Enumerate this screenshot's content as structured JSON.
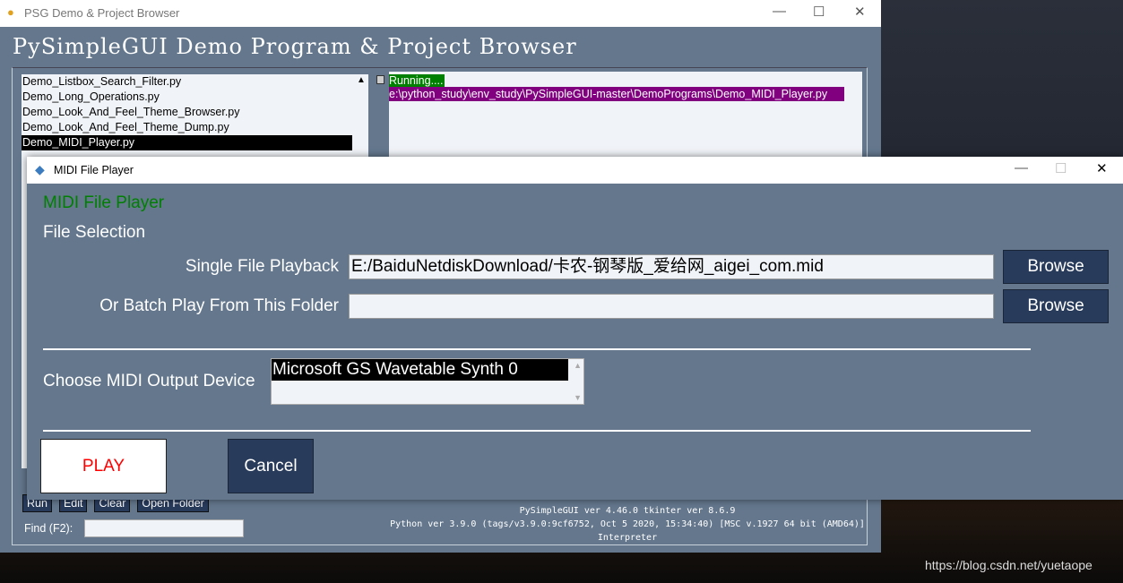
{
  "main_window": {
    "title": "PSG Demo & Project Browser",
    "heading": "PySimpleGUI Demo Program & Project Browser",
    "files": [
      "Demo_Listbox_Search_Filter.py",
      "Demo_Long_Operations.py",
      "Demo_Look_And_Feel_Theme_Browser.py",
      "Demo_Look_And_Feel_Theme_Dump.py",
      "Demo_MIDI_Player.py"
    ],
    "selected_file": "Demo_MIDI_Player.py",
    "output": {
      "running": "Running....",
      "path": "e:\\python_study\\env_study\\PySimpleGUI-master\\DemoPrograms\\Demo_MIDI_Player.py"
    },
    "buttons": {
      "run": "Run",
      "edit": "Edit",
      "clear": "Clear",
      "open_folder": "Open Folder"
    },
    "find_label": "Find (F2):",
    "find_value": "",
    "version_lines": [
      "PySimpleGUI ver 4.46.0  tkinter ver 8.6.9",
      "Python ver 3.9.0 (tags/v3.9.0:9cf6752, Oct  5 2020, 15:34:40) [MSC v.1927 64 bit (AMD64)]",
      "Interpreter"
    ]
  },
  "midi_window": {
    "title": "MIDI File Player",
    "heading": "MIDI File Player",
    "section": "File Selection",
    "single_label": "Single File Playback",
    "single_value": "E:/BaiduNetdiskDownload/卡农-钢琴版_爱给网_aigei_com.mid",
    "batch_label": "Or Batch Play From This Folder",
    "batch_value": "",
    "browse": "Browse",
    "device_label": "Choose MIDI Output Device",
    "devices": [
      "Microsoft GS Wavetable Synth 0"
    ],
    "play": "PLAY",
    "cancel": "Cancel"
  },
  "watermark": "https://blog.csdn.net/yuetaope",
  "colors": {
    "bg": "#64778d",
    "button": "#283b5b",
    "heading_green": "#008000",
    "play_red": "#ff0000",
    "path_bg": "#800080"
  }
}
